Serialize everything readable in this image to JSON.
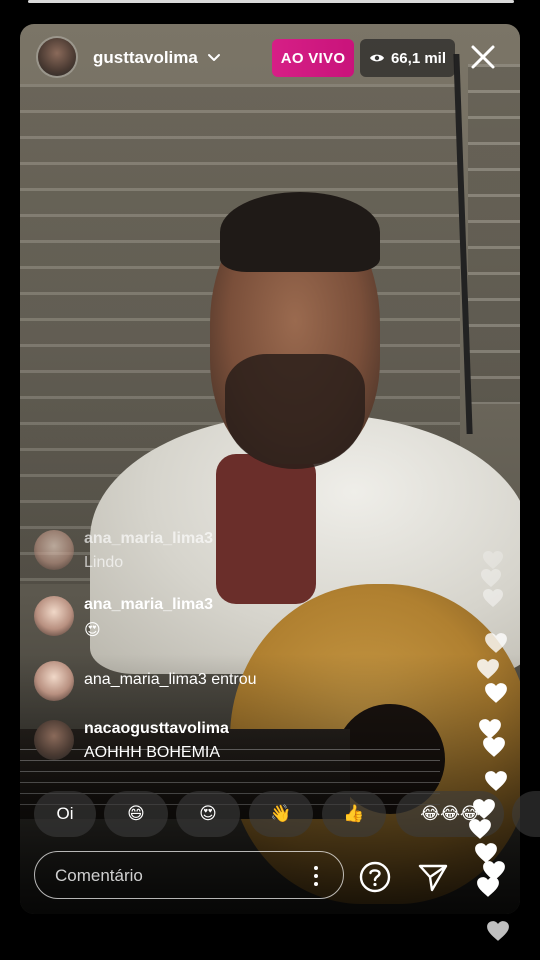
{
  "header": {
    "username": "gusttavolima",
    "live_label": "AO VIVO",
    "viewers": "66,1 mil",
    "chevron": "chevron-down-icon",
    "eye": "eye-icon",
    "close": "close-icon"
  },
  "comments": [
    {
      "user": "ana_maria_lima3",
      "text": "Lindo"
    },
    {
      "user": "ana_maria_lima3",
      "text": "😍"
    },
    {
      "user": "ana_maria_lima3",
      "text": "entrou"
    },
    {
      "user": "nacaogusttavolima",
      "text": "AOHHH BOHEMIA"
    }
  ],
  "quick_replies": [
    {
      "label": "Oi"
    },
    {
      "label": "😄"
    },
    {
      "label": "😍"
    },
    {
      "label": "👋"
    },
    {
      "label": "👍"
    },
    {
      "label": "😂😂😂"
    }
  ],
  "bottom": {
    "placeholder": "Comentário",
    "more": "more-vertical-icon",
    "help": "question-icon",
    "send": "send-icon",
    "hearts": "heart-icon"
  }
}
